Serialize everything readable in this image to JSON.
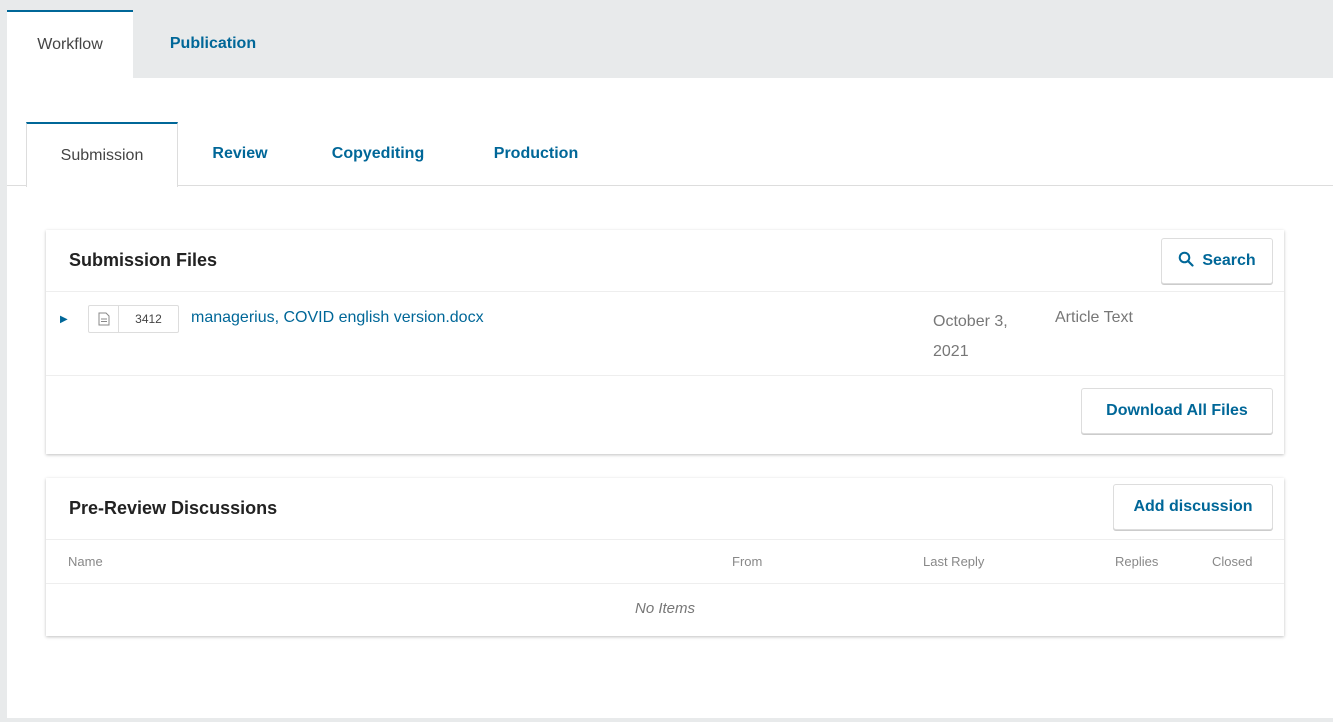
{
  "top_tabs": {
    "workflow": "Workflow",
    "publication": "Publication"
  },
  "sub_tabs": {
    "submission": "Submission",
    "review": "Review",
    "copyediting": "Copyediting",
    "production": "Production"
  },
  "submission_files": {
    "title": "Submission Files",
    "search_label": "Search",
    "file": {
      "id": "3412",
      "name": "managerius, COVID english version.docx",
      "date": "October 3, 2021",
      "type": "Article Text"
    },
    "download_all_label": "Download All Files"
  },
  "pre_review": {
    "title": "Pre-Review Discussions",
    "add_label": "Add discussion",
    "columns": {
      "name": "Name",
      "from": "From",
      "last_reply": "Last Reply",
      "replies": "Replies",
      "closed": "Closed"
    },
    "empty_text": "No Items"
  },
  "colors": {
    "accent": "#006798",
    "background": "#e8eaeb"
  },
  "icons": {
    "expander": "triangle-right-icon",
    "file": "document-icon",
    "search": "search-icon"
  }
}
